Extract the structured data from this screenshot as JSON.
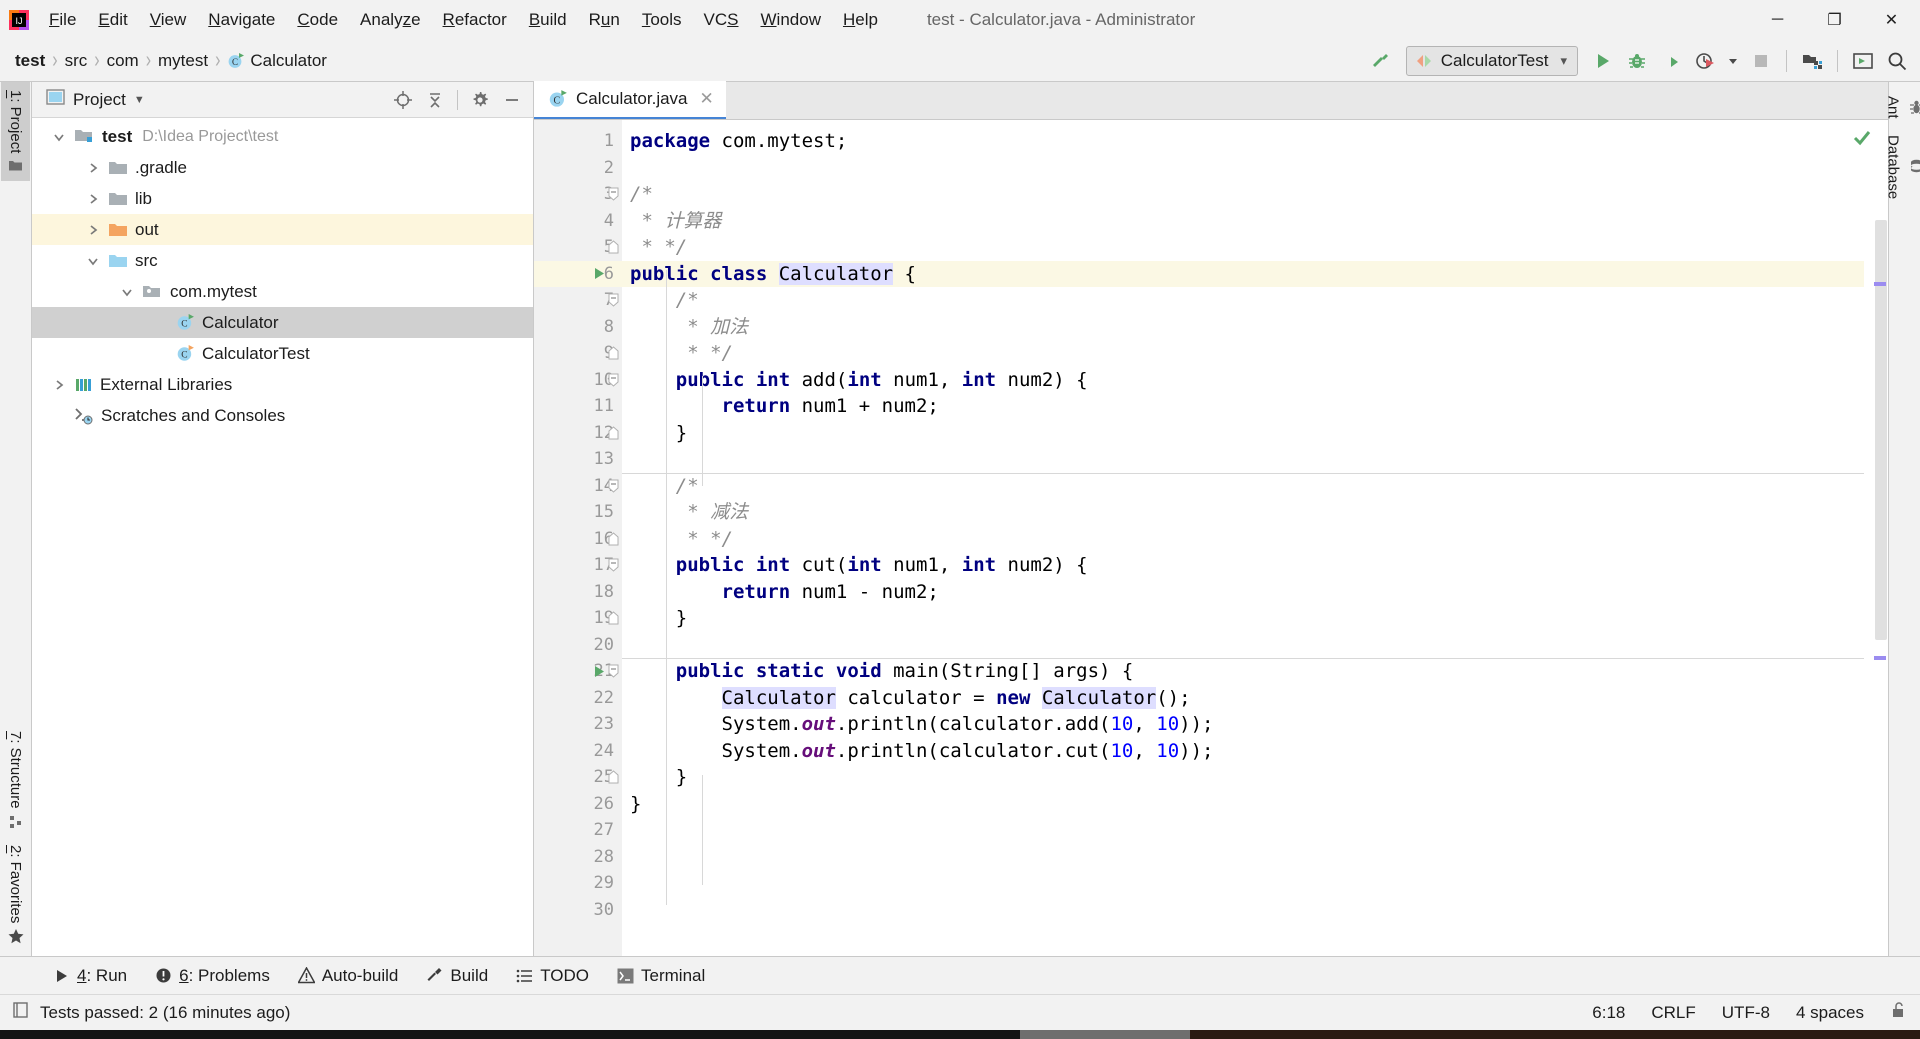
{
  "window": {
    "title": "test - Calculator.java - Administrator",
    "controls": {
      "minimize": "─",
      "maximize": "❐",
      "close": "✕"
    }
  },
  "menubar": [
    {
      "label": "File"
    },
    {
      "label": "Edit"
    },
    {
      "label": "View"
    },
    {
      "label": "Navigate"
    },
    {
      "label": "Code"
    },
    {
      "label": "Analyze"
    },
    {
      "label": "Refactor"
    },
    {
      "label": "Build"
    },
    {
      "label": "Run"
    },
    {
      "label": "Tools"
    },
    {
      "label": "VCS"
    },
    {
      "label": "Window"
    },
    {
      "label": "Help"
    }
  ],
  "breadcrumb": {
    "separator": "›",
    "items": [
      {
        "label": "test",
        "bold": true
      },
      {
        "label": "src",
        "bold": false
      },
      {
        "label": "com",
        "bold": false
      },
      {
        "label": "mytest",
        "bold": false
      },
      {
        "label": "Calculator",
        "bold": false,
        "icon": "java-class-icon"
      }
    ]
  },
  "toolbar": {
    "build_icon": "hammer-icon",
    "run_config": {
      "label": "CalculatorTest",
      "icon": "run-config-icon",
      "chevron": "⌄"
    },
    "buttons": [
      {
        "name": "run-button",
        "icon": "play-icon"
      },
      {
        "name": "debug-button",
        "icon": "bug-icon"
      },
      {
        "name": "run-with-coverage-button",
        "icon": "coverage-icon"
      },
      {
        "name": "profile-button",
        "icon": "profiler-icon"
      },
      {
        "name": "profile-dropdown",
        "icon": "chevron-down-icon"
      },
      {
        "name": "stop-button",
        "icon": "stop-icon"
      },
      {
        "name": "project-structure-button",
        "icon": "project-structure-icon"
      },
      {
        "name": "console-button",
        "icon": "console-icon"
      },
      {
        "name": "search-everywhere-button",
        "icon": "search-icon"
      }
    ]
  },
  "left_rail": {
    "top": [
      {
        "label": "1: Project",
        "accel": "1",
        "rest": ": Project",
        "icon": "folder-icon",
        "active": true
      }
    ],
    "bottom": [
      {
        "label": "7: Structure",
        "accel": "7",
        "rest": ": Structure",
        "icon": "structure-icon",
        "active": false
      },
      {
        "label": "2: Favorites",
        "accel": "2",
        "rest": ": Favorites",
        "icon": "star-icon",
        "active": false
      }
    ]
  },
  "right_rail": [
    {
      "label": "Ant",
      "icon": "ant-icon"
    },
    {
      "label": "Database",
      "icon": "database-icon"
    }
  ],
  "project_panel": {
    "title": "Project",
    "title_chevron": "▼",
    "view_icon": "project-view-icon",
    "actions": [
      {
        "name": "scroll-from-source-button",
        "icon": "target-icon"
      },
      {
        "name": "collapse-all-button",
        "icon": "collapse-all-icon"
      },
      {
        "name": "settings-button",
        "icon": "gear-icon"
      },
      {
        "name": "hide-button",
        "icon": "minimize-icon"
      }
    ],
    "tree": [
      {
        "label": "test",
        "path": "D:\\Idea Project\\test",
        "indent": 0,
        "twist": "⌄",
        "icon": "module-folder-icon",
        "bold": true,
        "state": "normal"
      },
      {
        "label": ".gradle",
        "path": "",
        "indent": 1,
        "twist": "›",
        "icon": "folder-gray-icon",
        "bold": false,
        "state": "normal"
      },
      {
        "label": "lib",
        "path": "",
        "indent": 1,
        "twist": "›",
        "icon": "folder-gray-icon",
        "bold": false,
        "state": "normal"
      },
      {
        "label": "out",
        "path": "",
        "indent": 1,
        "twist": "›",
        "icon": "folder-orange-icon",
        "bold": false,
        "state": "highlighted"
      },
      {
        "label": "src",
        "path": "",
        "indent": 1,
        "twist": "⌄",
        "icon": "folder-blue-icon",
        "bold": false,
        "state": "normal"
      },
      {
        "label": "com.mytest",
        "path": "",
        "indent": 2,
        "twist": "⌄",
        "icon": "package-icon",
        "bold": false,
        "state": "normal"
      },
      {
        "label": "Calculator",
        "path": "",
        "indent": 3,
        "twist": "",
        "icon": "java-class-icon",
        "bold": false,
        "state": "selected"
      },
      {
        "label": "CalculatorTest",
        "path": "",
        "indent": 3,
        "twist": "",
        "icon": "java-test-class-icon",
        "bold": false,
        "state": "normal"
      },
      {
        "label": "External Libraries",
        "path": "",
        "indent": 0,
        "twist": "›",
        "icon": "libraries-icon",
        "bold": false,
        "state": "normal"
      },
      {
        "label": "Scratches and Consoles",
        "path": "",
        "indent": 0,
        "twist": "",
        "icon": "scratches-icon",
        "bold": false,
        "state": "normal"
      }
    ]
  },
  "editor": {
    "tabs": [
      {
        "label": "Calculator.java",
        "icon": "java-class-icon",
        "close": "✕",
        "active": true
      }
    ],
    "inspection_status": "ok",
    "lines": [
      {
        "n": 1,
        "gutter": "",
        "fold": "",
        "hl": false,
        "rule": false,
        "tokens": [
          {
            "t": "package ",
            "c": "kw"
          },
          {
            "t": "com.mytest;",
            "c": "ident"
          }
        ]
      },
      {
        "n": 2,
        "gutter": "",
        "fold": "",
        "hl": false,
        "rule": false,
        "tokens": []
      },
      {
        "n": 3,
        "gutter": "",
        "fold": "open",
        "hl": false,
        "rule": false,
        "tokens": [
          {
            "t": "/*",
            "c": "cmt"
          }
        ]
      },
      {
        "n": 4,
        "gutter": "",
        "fold": "",
        "hl": false,
        "rule": false,
        "tokens": [
          {
            "t": " * 计算器",
            "c": "cmt"
          }
        ]
      },
      {
        "n": 5,
        "gutter": "",
        "fold": "close",
        "hl": false,
        "rule": false,
        "tokens": [
          {
            "t": " * */",
            "c": "cmt"
          }
        ]
      },
      {
        "n": 6,
        "gutter": "run",
        "fold": "",
        "hl": true,
        "rule": false,
        "tokens": [
          {
            "t": "public class ",
            "c": "kw"
          },
          {
            "t": "Calculator",
            "c": "tok-hl"
          },
          {
            "t": " {",
            "c": "ident"
          }
        ]
      },
      {
        "n": 7,
        "gutter": "",
        "fold": "open",
        "hl": false,
        "rule": false,
        "tokens": [
          {
            "t": "    /*",
            "c": "cmt"
          }
        ]
      },
      {
        "n": 8,
        "gutter": "",
        "fold": "",
        "hl": false,
        "rule": false,
        "tokens": [
          {
            "t": "     * 加法",
            "c": "cmt"
          }
        ]
      },
      {
        "n": 9,
        "gutter": "",
        "fold": "close",
        "hl": false,
        "rule": false,
        "tokens": [
          {
            "t": "     * */",
            "c": "cmt"
          }
        ]
      },
      {
        "n": 10,
        "gutter": "",
        "fold": "open",
        "hl": false,
        "rule": false,
        "tokens": [
          {
            "t": "    ",
            "c": "ident"
          },
          {
            "t": "public int ",
            "c": "kw"
          },
          {
            "t": "add(",
            "c": "ident"
          },
          {
            "t": "int ",
            "c": "kw"
          },
          {
            "t": "num1, ",
            "c": "ident"
          },
          {
            "t": "int ",
            "c": "kw"
          },
          {
            "t": "num2) {",
            "c": "ident"
          }
        ]
      },
      {
        "n": 11,
        "gutter": "",
        "fold": "",
        "hl": false,
        "rule": false,
        "tokens": [
          {
            "t": "        ",
            "c": "ident"
          },
          {
            "t": "return ",
            "c": "kw"
          },
          {
            "t": "num1 + num2;",
            "c": "ident"
          }
        ]
      },
      {
        "n": 12,
        "gutter": "",
        "fold": "close",
        "hl": false,
        "rule": false,
        "tokens": [
          {
            "t": "    }",
            "c": "ident"
          }
        ]
      },
      {
        "n": 13,
        "gutter": "",
        "fold": "",
        "hl": false,
        "rule": false,
        "tokens": []
      },
      {
        "n": 14,
        "gutter": "",
        "fold": "open",
        "hl": false,
        "rule": true,
        "tokens": [
          {
            "t": "    /*",
            "c": "cmt"
          }
        ]
      },
      {
        "n": 15,
        "gutter": "",
        "fold": "",
        "hl": false,
        "rule": false,
        "tokens": [
          {
            "t": "     * 减法",
            "c": "cmt"
          }
        ]
      },
      {
        "n": 16,
        "gutter": "",
        "fold": "close",
        "hl": false,
        "rule": false,
        "tokens": [
          {
            "t": "     * */",
            "c": "cmt"
          }
        ]
      },
      {
        "n": 17,
        "gutter": "",
        "fold": "open",
        "hl": false,
        "rule": false,
        "tokens": [
          {
            "t": "    ",
            "c": "ident"
          },
          {
            "t": "public int ",
            "c": "kw"
          },
          {
            "t": "cut(",
            "c": "ident"
          },
          {
            "t": "int ",
            "c": "kw"
          },
          {
            "t": "num1, ",
            "c": "ident"
          },
          {
            "t": "int ",
            "c": "kw"
          },
          {
            "t": "num2) {",
            "c": "ident"
          }
        ]
      },
      {
        "n": 18,
        "gutter": "",
        "fold": "",
        "hl": false,
        "rule": false,
        "tokens": [
          {
            "t": "        ",
            "c": "ident"
          },
          {
            "t": "return ",
            "c": "kw"
          },
          {
            "t": "num1 - num2;",
            "c": "ident"
          }
        ]
      },
      {
        "n": 19,
        "gutter": "",
        "fold": "close",
        "hl": false,
        "rule": false,
        "tokens": [
          {
            "t": "    }",
            "c": "ident"
          }
        ]
      },
      {
        "n": 20,
        "gutter": "",
        "fold": "",
        "hl": false,
        "rule": false,
        "tokens": []
      },
      {
        "n": 21,
        "gutter": "run",
        "fold": "open",
        "hl": false,
        "rule": true,
        "tokens": [
          {
            "t": "    ",
            "c": "ident"
          },
          {
            "t": "public static void ",
            "c": "kw"
          },
          {
            "t": "main(String[] args) {",
            "c": "ident"
          }
        ]
      },
      {
        "n": 22,
        "gutter": "",
        "fold": "",
        "hl": false,
        "rule": false,
        "tokens": [
          {
            "t": "        ",
            "c": "ident"
          },
          {
            "t": "Calculator",
            "c": "tok-hl"
          },
          {
            "t": " calculator = ",
            "c": "ident"
          },
          {
            "t": "new ",
            "c": "kw"
          },
          {
            "t": "Calculator",
            "c": "tok-hl"
          },
          {
            "t": "();",
            "c": "ident"
          }
        ]
      },
      {
        "n": 23,
        "gutter": "",
        "fold": "",
        "hl": false,
        "rule": false,
        "tokens": [
          {
            "t": "        System.",
            "c": "ident"
          },
          {
            "t": "out",
            "c": "stat"
          },
          {
            "t": ".println(calculator.add(",
            "c": "ident"
          },
          {
            "t": "10",
            "c": "num"
          },
          {
            "t": ", ",
            "c": "ident"
          },
          {
            "t": "10",
            "c": "num"
          },
          {
            "t": "));",
            "c": "ident"
          }
        ]
      },
      {
        "n": 24,
        "gutter": "",
        "fold": "",
        "hl": false,
        "rule": false,
        "tokens": [
          {
            "t": "        System.",
            "c": "ident"
          },
          {
            "t": "out",
            "c": "stat"
          },
          {
            "t": ".println(calculator.cut(",
            "c": "ident"
          },
          {
            "t": "10",
            "c": "num"
          },
          {
            "t": ", ",
            "c": "ident"
          },
          {
            "t": "10",
            "c": "num"
          },
          {
            "t": "));",
            "c": "ident"
          }
        ]
      },
      {
        "n": 25,
        "gutter": "",
        "fold": "close",
        "hl": false,
        "rule": false,
        "tokens": [
          {
            "t": "    }",
            "c": "ident"
          }
        ]
      },
      {
        "n": 26,
        "gutter": "",
        "fold": "",
        "hl": false,
        "rule": false,
        "tokens": [
          {
            "t": "}",
            "c": "ident"
          }
        ]
      },
      {
        "n": 27,
        "gutter": "",
        "fold": "",
        "hl": false,
        "rule": false,
        "tokens": []
      },
      {
        "n": 28,
        "gutter": "",
        "fold": "",
        "hl": false,
        "rule": false,
        "tokens": []
      },
      {
        "n": 29,
        "gutter": "",
        "fold": "",
        "hl": false,
        "rule": false,
        "tokens": []
      },
      {
        "n": 30,
        "gutter": "",
        "fold": "",
        "hl": false,
        "rule": false,
        "tokens": []
      }
    ]
  },
  "bottom_bar": [
    {
      "label": "4: Run",
      "accel": "4",
      "rest": ": Run",
      "icon": "play-icon"
    },
    {
      "label": "6: Problems",
      "accel": "6",
      "rest": ": Problems",
      "icon": "problems-icon"
    },
    {
      "label": "Auto-build",
      "accel": "",
      "rest": "Auto-build",
      "icon": "warning-icon"
    },
    {
      "label": "Build",
      "accel": "",
      "rest": "Build",
      "icon": "hammer-icon"
    },
    {
      "label": "TODO",
      "accel": "",
      "rest": "TODO",
      "icon": "todo-icon"
    },
    {
      "label": "Terminal",
      "accel": "",
      "rest": "Terminal",
      "icon": "terminal-icon"
    }
  ],
  "status_bar": {
    "left_icon": "test-results-icon",
    "message": "Tests passed: 2 (16 minutes ago)",
    "caret": "6:18",
    "line_separator": "CRLF",
    "encoding": "UTF-8",
    "indent": "4 spaces",
    "lock_icon": "unlocked-icon"
  },
  "colors": {
    "accent": "#4584d5",
    "run_green": "#59a869",
    "keyword": "#000080",
    "comment": "#8c8c8c",
    "number": "#0000ff",
    "static_field": "#660e7a",
    "highlight_line": "#fbf8e4",
    "selection": "#dedeff",
    "folder_orange": "#f4a460",
    "folder_blue": "#9ad4f0"
  }
}
